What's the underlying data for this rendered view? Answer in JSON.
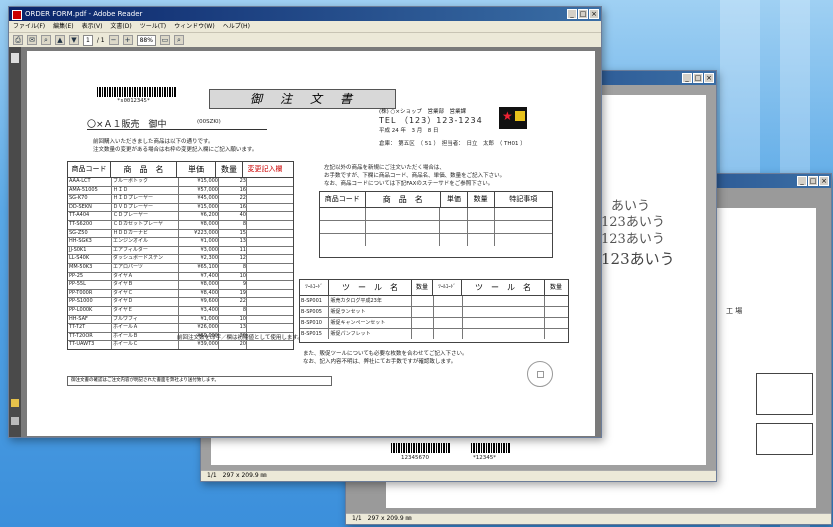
{
  "front_window": {
    "title": "ORDER FORM.pdf - Adobe Reader",
    "menu": [
      "ファイル(F)",
      "編集(E)",
      "表示(V)",
      "文書(D)",
      "ツール(T)",
      "ウィンドウ(W)",
      "ヘルプ(H)"
    ],
    "page_input": "1",
    "page_total": "/ 1",
    "zoom": "88%",
    "controls": {
      "minimize": "_",
      "maximize": "□",
      "close": "×"
    }
  },
  "order_form": {
    "title": "御　注　文　書",
    "barcode_number": "*s0012345*",
    "customer": "〇×Ａ１販売　御中",
    "customer_code": "(00SZKI)",
    "intro_line1": "前回購入いただきました商品は以下の通りです。",
    "intro_line2": "注文数量の変更がある場合は右枠の変更記入欄にご記入願います。",
    "company": "(株) ○×ショップ　営業部　営業課",
    "tel": "TEL （123）123-1234",
    "date": "平成 24 年　3 月　8 日",
    "meta_line": "倉庫：　第五区　（  51  ）　担当者：　日立　太郎　（  TH01  ）",
    "table1_headers": [
      "商品コード",
      "商　品　名",
      "単価",
      "数量",
      "変更記入欄"
    ],
    "table1_rows": [
      [
        "AAA-LCT",
        "ブルーボトック",
        "¥15,000",
        "23"
      ],
      [
        "AMA-51005",
        "ＨＩＤ",
        "¥57,000",
        "16"
      ],
      [
        "SG-K70",
        "ＨＩＤプレーヤー",
        "¥45,000",
        "22"
      ],
      [
        "DD-SEKN",
        "ＤＶＤプレーヤー",
        "¥15,000",
        "16"
      ],
      [
        "TT-A404",
        "ＣＤプレーヤー",
        "¥6,200",
        "40"
      ],
      [
        "TT-S6200",
        "ＣＤカセットプレーヤ",
        "¥8,000",
        "8"
      ],
      [
        "SG-Z50",
        "ＨＤＤカーナビ",
        "¥223,000",
        "15"
      ],
      [
        "HH-SGK3",
        "エンジンオイル",
        "¥1,000",
        "13"
      ],
      [
        "JJ-S0K1",
        "エアフィルター",
        "¥3,000",
        "11"
      ],
      [
        "LL-S40K",
        "ダッシュボードステン",
        "¥2,300",
        "12"
      ],
      [
        "MM-50K3",
        "エアロパーツ",
        "¥65,100",
        "8"
      ],
      [
        "PP-25",
        "タイヤＡ",
        "¥7,400",
        "10"
      ],
      [
        "PP-55L",
        "タイヤＢ",
        "¥8,000",
        "9"
      ],
      [
        "PP-T000R",
        "タイヤＣ",
        "¥8,400",
        "19"
      ],
      [
        "PP-S1000",
        "タイヤＤ",
        "¥9,600",
        "22"
      ],
      [
        "PP-L000K",
        "タイヤＥ",
        "¥3,400",
        "8"
      ],
      [
        "HH-SAF",
        "ブルワフィ",
        "¥1,000",
        "10"
      ],
      [
        "TT-T2T",
        "ホイールＡ",
        "¥26,000",
        "13"
      ],
      [
        "TT-T20OR",
        "ホイールＢ",
        "¥69,000",
        "20"
      ],
      [
        "TT-UAWT3",
        "ホイールＣ",
        "¥39,000",
        "20"
      ]
    ],
    "table1_footer": "前回注文数を印字／欄は初期値として使用します。",
    "right_note_line1": "左記以外の商品を新規にご注文いただく場合は、",
    "right_note_line2": "お手数ですが、下欄に商品コード、商品名、単価、数量をご記入下さい。",
    "right_note_line3": "なお、商品コードについては下記FAXのステーサドをご参照下さい。",
    "table2_headers": [
      "商品コード",
      "商　品　名",
      "単価",
      "数量",
      "特記事項"
    ],
    "table3_headers": [
      "ﾂｰﾙｺｰﾄﾞ",
      "ツ　ー　ル　名",
      "数量",
      "ﾂｰﾙｺｰﾄﾞ",
      "ツ　ー　ル　名",
      "数量"
    ],
    "table3_rows": [
      [
        "B-SP001",
        "販売カタログ平成23年"
      ],
      [
        "B-SP005",
        "販促ランセット"
      ],
      [
        "B-SP010",
        "販促キャンペーンセット"
      ],
      [
        "B-SP015",
        "販促パンフレット"
      ]
    ],
    "bottom_note_line1": "また、販促ツールについても必要な枚数を合わせてご記入下さい。",
    "bottom_note_line2": "なお、記入内容不明は、弊社にてお手数ですが確認致します。",
    "footer_bar": "御注文書の確認はご注文内容が明記された書面を弊社より送付致します。"
  },
  "back_window": {
    "status_page": "1/1",
    "status_size": "297 x 209.9 ㎜",
    "barcode_label_1": "12345670",
    "barcode_label_2": "*12345*",
    "sample_text_1": "あいう",
    "sample_text_2": "123あいう",
    "sample_text_3": "123あいう",
    "sample_text_4": "123あいう",
    "factory_label": "工 場"
  },
  "colors": {
    "title_bar": "#0a246a",
    "background": "#5aa8e6",
    "accent_red": "#cc0000"
  }
}
